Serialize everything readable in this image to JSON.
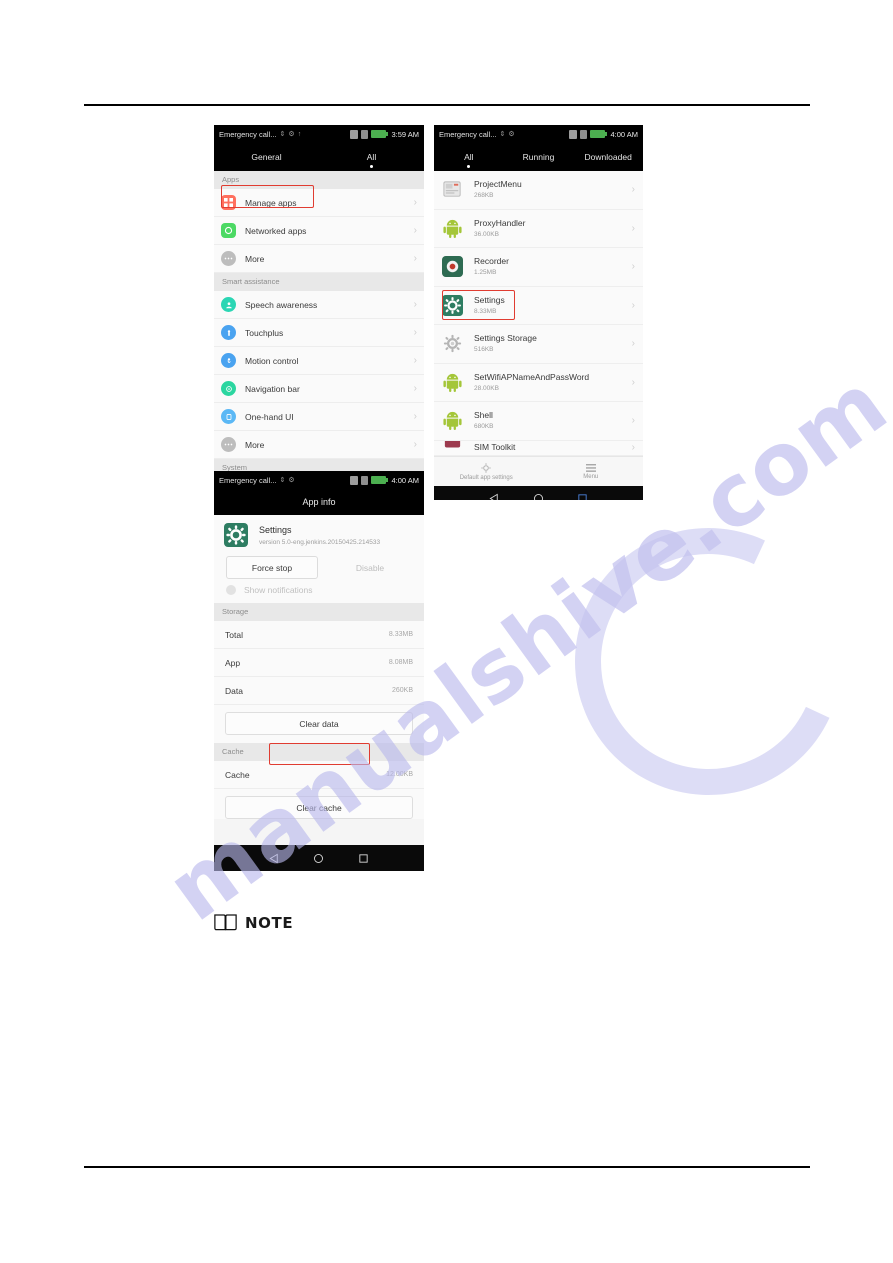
{
  "document": {
    "note_label": "NOTE",
    "note_icon": "book-icon",
    "watermark_text": "manualshive.com"
  },
  "accent": {
    "highlight_red": "#e03c31",
    "battery_green": "#4caf50"
  },
  "screenshot_settings_general": {
    "name": "settings-home-screenshot",
    "statusbar": {
      "carrier": "Emergency call...",
      "icons": [
        "usb-icon",
        "debug-icon",
        "sync-icon"
      ],
      "right_icons": [
        "sd-card-icon",
        "sim-icon",
        "battery-icon"
      ],
      "time": "3:59 AM"
    },
    "tabs": [
      {
        "label": "General",
        "active": false
      },
      {
        "label": "All",
        "active": true
      }
    ],
    "sections": [
      {
        "header": "Apps",
        "items": [
          {
            "label": "Manage apps",
            "icon": "manage-apps-icon",
            "icon_color": "#ff6f5e",
            "highlighted": true
          },
          {
            "label": "Networked apps",
            "icon": "networked-apps-icon",
            "icon_color": "#4cd964",
            "highlighted": false
          },
          {
            "label": "More",
            "icon": "more-icon",
            "icon_color": "#bdbdbd",
            "highlighted": false
          }
        ]
      },
      {
        "header": "Smart assistance",
        "items": [
          {
            "label": "Speech awareness",
            "icon": "speech-awareness-icon",
            "icon_color": "#2bd6b4",
            "highlighted": false
          },
          {
            "label": "Touchplus",
            "icon": "touchplus-icon",
            "icon_color": "#4aa3f0",
            "highlighted": false
          },
          {
            "label": "Motion control",
            "icon": "motion-control-icon",
            "icon_color": "#4aa3f0",
            "highlighted": false
          },
          {
            "label": "Navigation bar",
            "icon": "navigation-bar-icon",
            "icon_color": "#2bd6a0",
            "highlighted": false
          },
          {
            "label": "One-hand UI",
            "icon": "one-hand-ui-icon",
            "icon_color": "#5bb8f5",
            "highlighted": false
          },
          {
            "label": "More",
            "icon": "more-icon",
            "icon_color": "#bdbdbd",
            "highlighted": false
          }
        ]
      },
      {
        "header": "System",
        "items": []
      }
    ],
    "navbar": [
      "back-icon",
      "home-icon",
      "recents-icon"
    ]
  },
  "screenshot_app_info": {
    "name": "app-info-screenshot",
    "statusbar": {
      "carrier": "Emergency call...",
      "time": "4:00 AM"
    },
    "title": "App info",
    "app": {
      "name": "Settings",
      "version": "version 5.0-eng.jenkins.20150425.214533",
      "icon": "settings-gear-icon"
    },
    "actions": {
      "force_stop": "Force stop",
      "disable": "Disable",
      "show_notifications": "Show notifications"
    },
    "storage": {
      "header": "Storage",
      "rows": [
        {
          "key": "Total",
          "value": "8.33MB"
        },
        {
          "key": "App",
          "value": "8.08MB"
        },
        {
          "key": "Data",
          "value": "260KB"
        }
      ],
      "clear_data_button": "Clear data",
      "clear_data_highlighted": true
    },
    "cache": {
      "header": "Cache",
      "rows": [
        {
          "key": "Cache",
          "value": "12.00KB"
        }
      ],
      "clear_cache_button": "Clear cache"
    },
    "navbar": [
      "back-icon",
      "home-icon",
      "recents-icon"
    ]
  },
  "screenshot_manage_apps": {
    "name": "manage-apps-screenshot",
    "statusbar": {
      "carrier": "Emergency call...",
      "time": "4:00 AM"
    },
    "tabs": [
      {
        "label": "All",
        "active": true
      },
      {
        "label": "Running",
        "active": false
      },
      {
        "label": "Downloaded",
        "active": false
      }
    ],
    "apps": [
      {
        "name": "ProjectMenu",
        "size": "268KB",
        "icon": "projectmenu-icon",
        "icon_kind": "doc",
        "highlighted": false
      },
      {
        "name": "ProxyHandler",
        "size": "36.00KB",
        "icon": "android-icon",
        "icon_kind": "android",
        "highlighted": false
      },
      {
        "name": "Recorder",
        "size": "1.25MB",
        "icon": "recorder-icon",
        "icon_kind": "recorder",
        "highlighted": false
      },
      {
        "name": "Settings",
        "size": "8.33MB",
        "icon": "settings-gear-icon",
        "icon_kind": "gear",
        "highlighted": true
      },
      {
        "name": "Settings Storage",
        "size": "516KB",
        "icon": "settings-storage-icon",
        "icon_kind": "graygear",
        "highlighted": false
      },
      {
        "name": "SetWifiAPNameAndPassWord",
        "size": "28.00KB",
        "icon": "android-icon",
        "icon_kind": "android",
        "highlighted": false
      },
      {
        "name": "Shell",
        "size": "680KB",
        "icon": "android-icon",
        "icon_kind": "android",
        "highlighted": false
      },
      {
        "name": "SIM Toolkit",
        "size": "",
        "icon": "sim-toolkit-icon",
        "icon_kind": "sim",
        "highlighted": false
      }
    ],
    "bottom_toolbar": [
      {
        "label": "Default app settings",
        "icon": "gear-icon"
      },
      {
        "label": "Menu",
        "icon": "hamburger-menu-icon"
      }
    ],
    "navbar": [
      "back-icon",
      "home-icon",
      "recents-icon"
    ]
  }
}
